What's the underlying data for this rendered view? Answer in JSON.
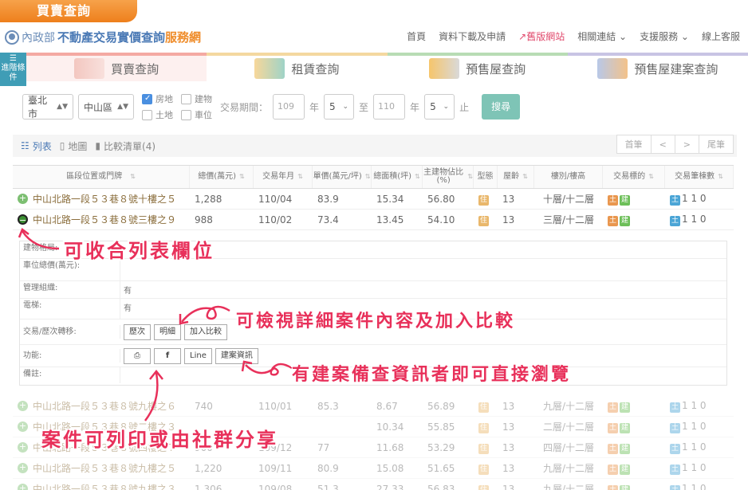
{
  "top_tab": "買賣查詢",
  "logo": {
    "ministry": "內政部",
    "main": "不動產交易實價查詢",
    "sub": "服務網"
  },
  "nav": [
    "首頁",
    "資料下載及申請",
    "舊版網站",
    "相關連結",
    "支援服務",
    "線上客服"
  ],
  "filter_button": "進階條件",
  "categories": [
    "買賣查詢",
    "租賃查詢",
    "預售屋查詢",
    "預售屋建案查詢"
  ],
  "search": {
    "city": "臺北市",
    "district": "中山區",
    "types": [
      "房地",
      "建物",
      "土地",
      "車位"
    ],
    "period_label": "交易期間：",
    "year_from": "109",
    "year_unit": "年",
    "month_from": "5",
    "to": "至",
    "year_to": "110",
    "month_to": "5",
    "until": "止",
    "button": "搜尋"
  },
  "view": {
    "list": "列表",
    "map": "地圖",
    "compare": "比較清單(4)"
  },
  "pager": [
    "首筆",
    "<",
    ">",
    "尾筆"
  ],
  "columns": [
    "區段位置或門牌",
    "總價(萬元)",
    "交易年月",
    "單價(萬元/坪)",
    "總面積(坪)",
    "主建物佔比(%)",
    "型態",
    "屋齡",
    "樓別/樓高",
    "交易標的",
    "交易筆棟數"
  ],
  "type_tag": "住",
  "tag_land": "土",
  "tag_build": "建",
  "rows": [
    {
      "addr": "中山北路一段５３巷８號十樓之５",
      "price": "1,288",
      "date": "110/04",
      "unit": "83.9",
      "area": "15.34",
      "ratio": "56.80",
      "age": "13",
      "floor": "十層/十二層",
      "count": "1 1 0"
    },
    {
      "addr": "中山北路一段５３巷８號三樓之９",
      "price": "988",
      "date": "110/02",
      "unit": "73.4",
      "area": "13.45",
      "ratio": "54.10",
      "age": "13",
      "floor": "三層/十二層",
      "count": "1 1 0"
    },
    {
      "addr": "中山北路一段５３巷８號九樓之６",
      "price": "740",
      "date": "110/01",
      "unit": "85.3",
      "area": "8.67",
      "ratio": "56.89",
      "age": "13",
      "floor": "九層/十二層",
      "count": "1 1 0"
    },
    {
      "addr": "中山北路一段５３巷８號二樓之３",
      "price": "",
      "date": "",
      "unit": "",
      "area": "10.34",
      "ratio": "55.85",
      "age": "13",
      "floor": "二層/十二層",
      "count": "1 1 0"
    },
    {
      "addr": "中山北路一段５３巷８號四樓之７",
      "price": "900",
      "date": "109/12",
      "unit": "77",
      "area": "11.68",
      "ratio": "53.29",
      "age": "13",
      "floor": "四層/十二層",
      "count": "1 1 0"
    },
    {
      "addr": "中山北路一段５３巷８號九樓之５",
      "price": "1,220",
      "date": "109/11",
      "unit": "80.9",
      "area": "15.08",
      "ratio": "51.65",
      "age": "13",
      "floor": "九層/十二層",
      "count": "1 1 0"
    },
    {
      "addr": "中山北路一段５３巷８號九樓之３",
      "price": "1,306",
      "date": "109/08",
      "unit": "51.3",
      "area": "27.33",
      "ratio": "56.83",
      "age": "13",
      "floor": "九層/十二層",
      "count": "1 1 0"
    }
  ],
  "detail": {
    "labels": [
      "建物格局:",
      "車位總價(萬元):",
      "管理組織:",
      "電梯:",
      "交易/歷次轉移:",
      "功能:",
      "備註:"
    ],
    "manage": "有",
    "elevator": "有",
    "history_btn": "歷次",
    "detail_btn": "明細",
    "compare_btn": "加入比較",
    "fb": "f",
    "line": "Line",
    "project": "建案資訊"
  },
  "annotations": {
    "collapse": "可收合列表欄位",
    "view_detail": "可檢視詳細案件內容及加入比較",
    "project_info": "有建案備查資訊者即可直接瀏覽",
    "share": "案件可列印或由社群分享"
  }
}
